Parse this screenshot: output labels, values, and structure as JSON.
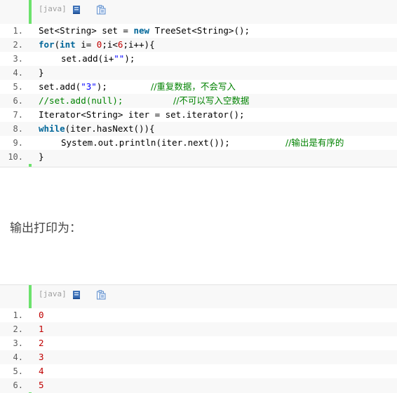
{
  "block1": {
    "lang": "[java]",
    "lines": [
      {
        "n": "1.",
        "a": "Set<String> set = ",
        "kw": "new",
        "b": " TreeSet<String>();"
      },
      {
        "n": "2.",
        "kw1": "for",
        "a": "(",
        "kw2": "int",
        "b": " i= ",
        "num1": "0",
        "c": ";i<",
        "num2": "6",
        "d": ";i++){"
      },
      {
        "n": "3.",
        "a": "set.add(i+",
        "str": "\"\"",
        "b": ");"
      },
      {
        "n": "4.",
        "a": "}"
      },
      {
        "n": "5.",
        "a": "set.add(",
        "str": "\"3\"",
        "b": ");",
        "cm": "//重复数据，不会写入"
      },
      {
        "n": "6.",
        "cm1": "//set.add(null);",
        "cm2": "//不可以写入空数据"
      },
      {
        "n": "7.",
        "a": "Iterator<String> iter = set.iterator();"
      },
      {
        "n": "8.",
        "kw": "while",
        "a": "(iter.hasNext()){"
      },
      {
        "n": "9.",
        "a": "System.out.println(iter.next());",
        "cm": "//输出是有序的"
      },
      {
        "n": "10.",
        "a": "}"
      }
    ]
  },
  "caption": "输出打印为：",
  "block2": {
    "lang": "[java]",
    "lines": [
      {
        "n": "1.",
        "v": "0"
      },
      {
        "n": "2.",
        "v": "1"
      },
      {
        "n": "3.",
        "v": "2"
      },
      {
        "n": "4.",
        "v": "3"
      },
      {
        "n": "5.",
        "v": "4"
      },
      {
        "n": "6.",
        "v": "5"
      }
    ]
  },
  "icons": {
    "view_source": "book-icon",
    "copy": "clipboard-icon"
  },
  "colors": {
    "keyword": "#006699",
    "string": "#0000ff",
    "number": "#c00000",
    "comment": "#008200",
    "gutter": "#6ce26c"
  }
}
